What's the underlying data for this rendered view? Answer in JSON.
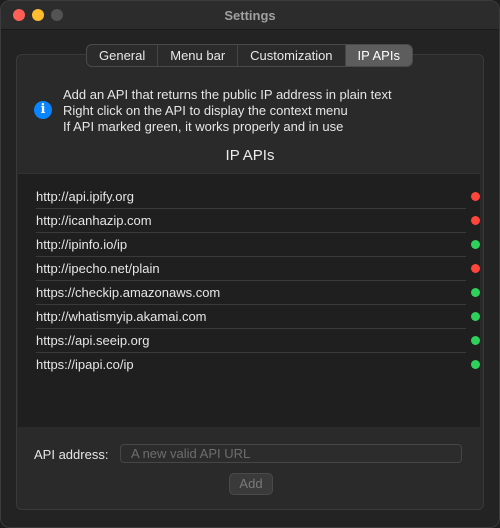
{
  "window": {
    "title": "Settings"
  },
  "tabs": [
    {
      "label": "General",
      "active": false
    },
    {
      "label": "Menu bar",
      "active": false
    },
    {
      "label": "Customization",
      "active": false
    },
    {
      "label": "IP APIs",
      "active": true
    }
  ],
  "info": {
    "icon": "info-icon",
    "lines": [
      "Add an API that returns the public IP address in plain text",
      "Right click on the API to display the context menu",
      "If API marked green, it works properly and in use"
    ]
  },
  "section_title": "IP APIs",
  "colors": {
    "status_ok": "#30d158",
    "status_error": "#ff453a",
    "accent": "#0a84ff"
  },
  "apis": [
    {
      "url": "http://api.ipify.org",
      "status": "error"
    },
    {
      "url": "http://icanhazip.com",
      "status": "error"
    },
    {
      "url": "http://ipinfo.io/ip",
      "status": "ok"
    },
    {
      "url": "http://ipecho.net/plain",
      "status": "error"
    },
    {
      "url": "https://checkip.amazonaws.com",
      "status": "ok"
    },
    {
      "url": "http://whatismyip.akamai.com",
      "status": "ok"
    },
    {
      "url": "https://api.seeip.org",
      "status": "ok"
    },
    {
      "url": "https://ipapi.co/ip",
      "status": "ok"
    }
  ],
  "form": {
    "label": "API address:",
    "placeholder": "A new valid API URL",
    "value": "",
    "add_label": "Add"
  }
}
